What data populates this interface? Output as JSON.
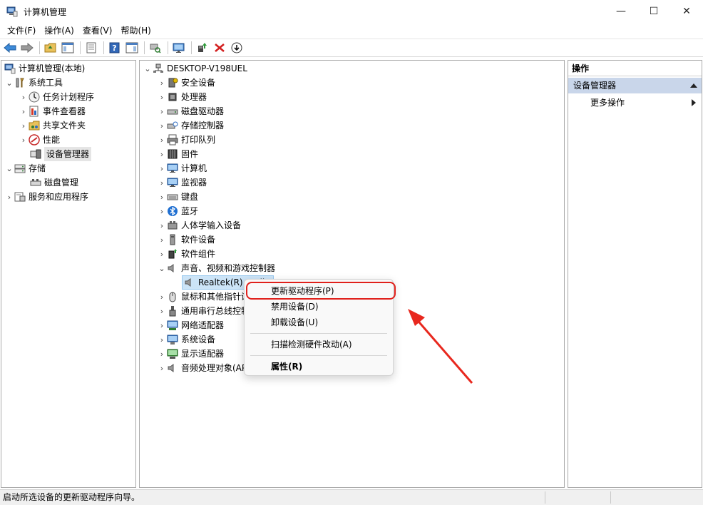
{
  "window": {
    "title": "计算机管理",
    "minimize": "—",
    "maximize": "☐",
    "close": "✕"
  },
  "menu": [
    "文件(F)",
    "操作(A)",
    "查看(V)",
    "帮助(H)"
  ],
  "left_tree": {
    "root": "计算机管理(本地)",
    "system_tools": "系统工具",
    "task_scheduler": "任务计划程序",
    "event_viewer": "事件查看器",
    "shared_folders": "共享文件夹",
    "performance": "性能",
    "device_manager": "设备管理器",
    "storage": "存储",
    "disk_management": "磁盘管理",
    "services_apps": "服务和应用程序"
  },
  "device_tree": {
    "computer_name": "DESKTOP-V198UEL",
    "categories": [
      "安全设备",
      "处理器",
      "磁盘驱动器",
      "存储控制器",
      "打印队列",
      "固件",
      "计算机",
      "监视器",
      "键盘",
      "蓝牙",
      "人体学输入设备",
      "软件设备",
      "软件组件",
      "声音、视频和游戏控制器"
    ],
    "selected_device": "Realtek(R) Audio",
    "categories_after": [
      "鼠标和其他指针设备",
      "通用串行总线控制器",
      "网络适配器",
      "系统设备",
      "显示适配器",
      "音频处理对象(APO)"
    ]
  },
  "context_menu": {
    "update_driver": "更新驱动程序(P)",
    "disable_device": "禁用设备(D)",
    "uninstall_device": "卸载设备(U)",
    "scan_hardware": "扫描检测硬件改动(A)",
    "properties": "属性(R)"
  },
  "actions_pane": {
    "header": "操作",
    "section": "设备管理器",
    "more_actions": "更多操作"
  },
  "status": {
    "text": "启动所选设备的更新驱动程序向导。"
  },
  "colors": {
    "highlight_red": "#e0201b",
    "section_blue": "#c9d6ea",
    "selection_blue": "#cce4f7"
  }
}
